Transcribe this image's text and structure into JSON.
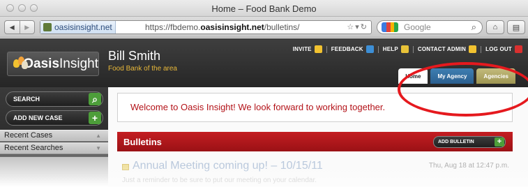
{
  "window": {
    "title": "Home – Food Bank Demo"
  },
  "browser": {
    "site_identity": "oasisinsight.net",
    "url_prefix": "https://fbdemo.",
    "url_domain": "oasisinsight.net",
    "url_path": "/bulletins/",
    "search_placeholder": "Google"
  },
  "app": {
    "logo_bold": "Oasis",
    "logo_light": "Insight",
    "user_name": "Bill Smith",
    "organization": "Food Bank of the area",
    "top_links": {
      "invite": "INVITE",
      "feedback": "FEEDBACK",
      "help": "HELP",
      "contact_admin": "CONTACT ADMIN",
      "logout": "LOG OUT"
    },
    "tabs": {
      "home": "Home",
      "my_agency": "My Agency",
      "agencies": "Agencies"
    }
  },
  "sidebar": {
    "search_label": "SEARCH",
    "add_case_label": "ADD NEW CASE",
    "recent_cases": "Recent Cases",
    "recent_searches": "Recent Searches"
  },
  "main": {
    "welcome": "Welcome to Oasis Insight! We look forward to working together.",
    "bulletins_heading": "Bulletins",
    "add_bulletin_label": "ADD BULLETIN",
    "bulletin": {
      "title": "Annual Meeting coming up! – 10/15/11",
      "date": "Thu, Aug 18 at 12:47 p.m.",
      "body": "Just a reminder to be sure to put our meeting on your calendar."
    }
  },
  "colors": {
    "accent_red": "#c41e22",
    "org_gold": "#e8b83a",
    "tab_agency_blue": "#2b5f8f",
    "tab_agencies_khaki": "#9e9652",
    "highlight_red": "#e5191e"
  }
}
